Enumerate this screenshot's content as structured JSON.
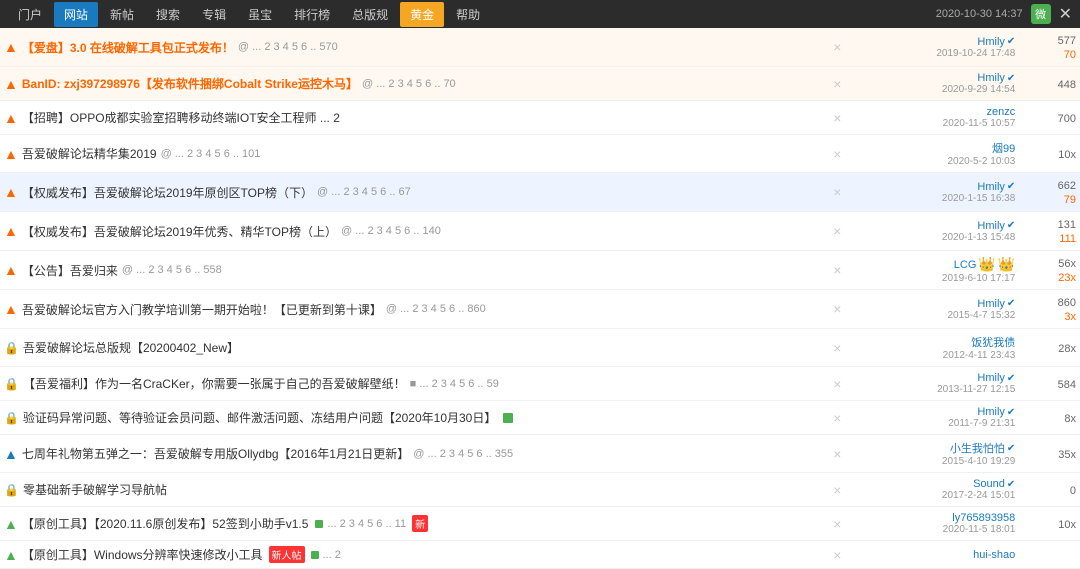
{
  "nav": {
    "tabs": [
      {
        "label": "门户",
        "active": false
      },
      {
        "label": "网站",
        "active": true
      },
      {
        "label": "新帖",
        "active": false
      },
      {
        "label": "搜索",
        "active": false
      },
      {
        "label": "专辑",
        "active": false
      },
      {
        "label": "虽宝",
        "active": false
      },
      {
        "label": "排行榜",
        "active": false
      },
      {
        "label": "总版规",
        "active": false
      },
      {
        "label": "黄金",
        "active": false,
        "gold": true
      },
      {
        "label": "帮助",
        "active": false
      }
    ],
    "right_info": "2020-10-30 14:37",
    "wechat": "微"
  },
  "posts": [
    {
      "type": "pinned",
      "icon": "arrow",
      "title": "【爱盘】3.0 在线破解工具包正式发布！",
      "meta": "@ ... 2 3 4 5 6 .. 570",
      "author": "Hmily",
      "verified": true,
      "date": "2019-10-24 17:48",
      "views": "577",
      "views2": "70",
      "bold": true,
      "color": "orange"
    },
    {
      "type": "pinned",
      "icon": "arrow",
      "title": "BanID: zxj397298976【发布软件捆绑Cobalt Strike运控木马】",
      "meta": "@ ... 2 3 4 5 6 .. 70",
      "author": "Hmily",
      "verified": true,
      "date": "2020-9-29 14:54",
      "views": "448",
      "bold": true,
      "color": "orange"
    },
    {
      "type": "pinned",
      "icon": "arrow",
      "title": "【招聘】OPPO成都实验室招聘移动终端IOT安全工程师 ... 2",
      "meta": "",
      "author": "zenzc",
      "verified": false,
      "date": "2020-11-5 10:57",
      "views": "700",
      "bold": false,
      "color": "normal"
    },
    {
      "type": "pinned",
      "icon": "arrow",
      "title": "吾爱破解论坛精华集2019",
      "meta": "@ ... 2 3 4 5 6 .. 101",
      "author": "烟99",
      "verified": false,
      "date": "2020-5-2 10:03",
      "views": "10x",
      "bold": false,
      "color": "normal"
    },
    {
      "type": "pinned",
      "icon": "arrow",
      "title": "【权威发布】吾爱破解论坛2019年原创区TOP榜（下）",
      "meta": "@ ... 2 3 4 5 6 .. 67",
      "author": "Hmily",
      "verified": true,
      "date": "2020-1-15 16:38",
      "views": "662",
      "views2": "79",
      "bold": false,
      "color": "normal",
      "highlight": true
    },
    {
      "type": "pinned",
      "icon": "arrow",
      "title": "【权威发布】吾爱破解论坛2019年优秀、精华TOP榜（上）",
      "meta": "@ ... 2 3 4 5 6 .. 140",
      "author": "Hmily",
      "verified": true,
      "date": "2020-1-13 15:48",
      "views": "131",
      "views2": "111",
      "bold": false,
      "color": "normal"
    },
    {
      "type": "pinned",
      "icon": "arrow",
      "title": "【公告】吾爱归来",
      "meta": "@ ... 2 3 4 5 6 .. 558",
      "author": "LCG",
      "verified": false,
      "crowns": true,
      "date": "2019-6-10 17:17",
      "views": "56x",
      "views2": "23x",
      "bold": false,
      "color": "normal"
    },
    {
      "type": "pinned",
      "icon": "arrow",
      "title": "吾爱破解论坛官方入门教学培训第一期开始啦！【已更新到第十课】",
      "meta": "@ ... 2 3 4 5 6 .. 860",
      "author": "Hmily",
      "verified": true,
      "date": "2015-4-7 15:32",
      "views": "860",
      "views2": "3x",
      "bold": false,
      "color": "normal"
    },
    {
      "type": "lock",
      "icon": "lock",
      "title": "吾爱破解论坛总版规【20200402_New】",
      "meta": "",
      "author": "饭犹我债",
      "verified": false,
      "date": "2012-4-11 23:43",
      "views": "28x",
      "bold": false,
      "color": "normal"
    },
    {
      "type": "lock",
      "icon": "lock",
      "title": "【吾爱福利】作为一名CraCKer，你需要一张属于自己的吾爱破解壁纸！",
      "meta": "■ ... 2 3 4 5 6 .. 59",
      "author": "Hmily",
      "verified": true,
      "date": "2013-11-27 12:15",
      "views": "584",
      "bold": false,
      "color": "normal"
    },
    {
      "type": "lock",
      "icon": "lock",
      "title": "验证码异常问题、等待验证会员问题、邮件激活问题、冻结用户问题【2020年10月30日】",
      "meta": "■",
      "author": "Hmily",
      "verified": true,
      "date": "2011-7-9 21:31",
      "views": "8x",
      "bold": false,
      "color": "normal"
    },
    {
      "type": "pinned",
      "icon": "arrow",
      "title": "七周年礼物第五弹之一：吾爱破解专用版Ollydbg【2016年1月21日更新】",
      "meta": "@ ... 2 3 4 5 6 .. 355",
      "author": "小生我怕怕",
      "verified": true,
      "date": "2015-4-10 19:29",
      "views": "35x",
      "bold": false,
      "color": "normal"
    },
    {
      "type": "lock",
      "icon": "lock",
      "title": "零基础新手破解学习导航帖",
      "meta": "",
      "author": "Sound",
      "verified": true,
      "date": "2017-2-24 15:01",
      "views": "0",
      "bold": false,
      "color": "normal"
    },
    {
      "type": "normal",
      "icon": "arrow",
      "title": "【原创工具】【2020.11.6原创发布】52签到小助手v1.5",
      "meta": "■ ... 2 3 4 5 6 .. 11",
      "tag": "new",
      "author": "ly765893958",
      "verified": false,
      "date": "2020-11-5 18:01",
      "views": "10x",
      "bold": false,
      "color": "green"
    },
    {
      "type": "normal",
      "icon": "arrow",
      "title": "【原创工具】Windows分辨率快速修改小工具",
      "meta": "■ ... 2",
      "tag": "newred",
      "tag2": "img",
      "author": "hui-shao",
      "verified": false,
      "date": "",
      "views": "",
      "bold": false,
      "color": "green"
    }
  ]
}
